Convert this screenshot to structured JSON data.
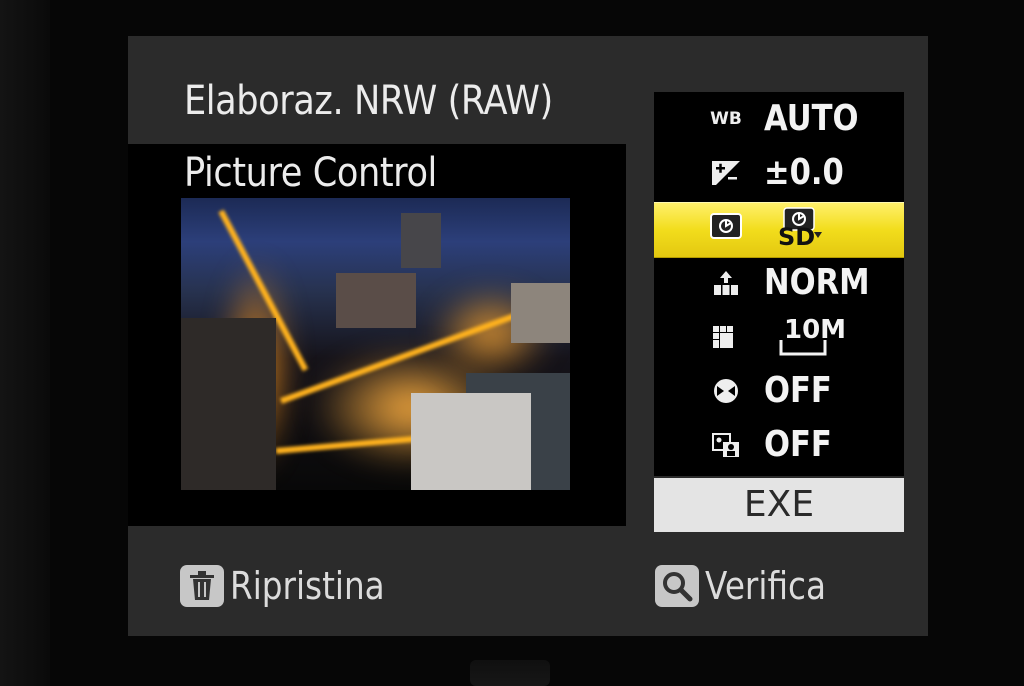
{
  "screen": {
    "title": "Elaboraz. NRW (RAW)",
    "subtitle": "Picture Control"
  },
  "menu": {
    "items": [
      {
        "icon": "white-balance-icon",
        "icon_text": "WB",
        "value": "AUTO",
        "selected": false
      },
      {
        "icon": "exposure-compensation-icon",
        "value": "±0.0",
        "selected": false
      },
      {
        "icon": "picture-control-icon",
        "value": "SD",
        "selected": true
      },
      {
        "icon": "image-quality-icon",
        "value": "NORM",
        "selected": false
      },
      {
        "icon": "image-size-icon",
        "value": "10M",
        "selected": false
      },
      {
        "icon": "d-lighting-icon",
        "value": "OFF",
        "selected": false
      },
      {
        "icon": "noise-reduction-icon",
        "value": "OFF",
        "selected": false
      }
    ],
    "exe_label": "EXE"
  },
  "footer": {
    "reset_label": "Ripristina",
    "review_label": "Verifica"
  },
  "colors": {
    "highlight": "#f2dd1c",
    "screen_bg": "#2b2b2b",
    "exe_bg": "#e4e4e4"
  }
}
